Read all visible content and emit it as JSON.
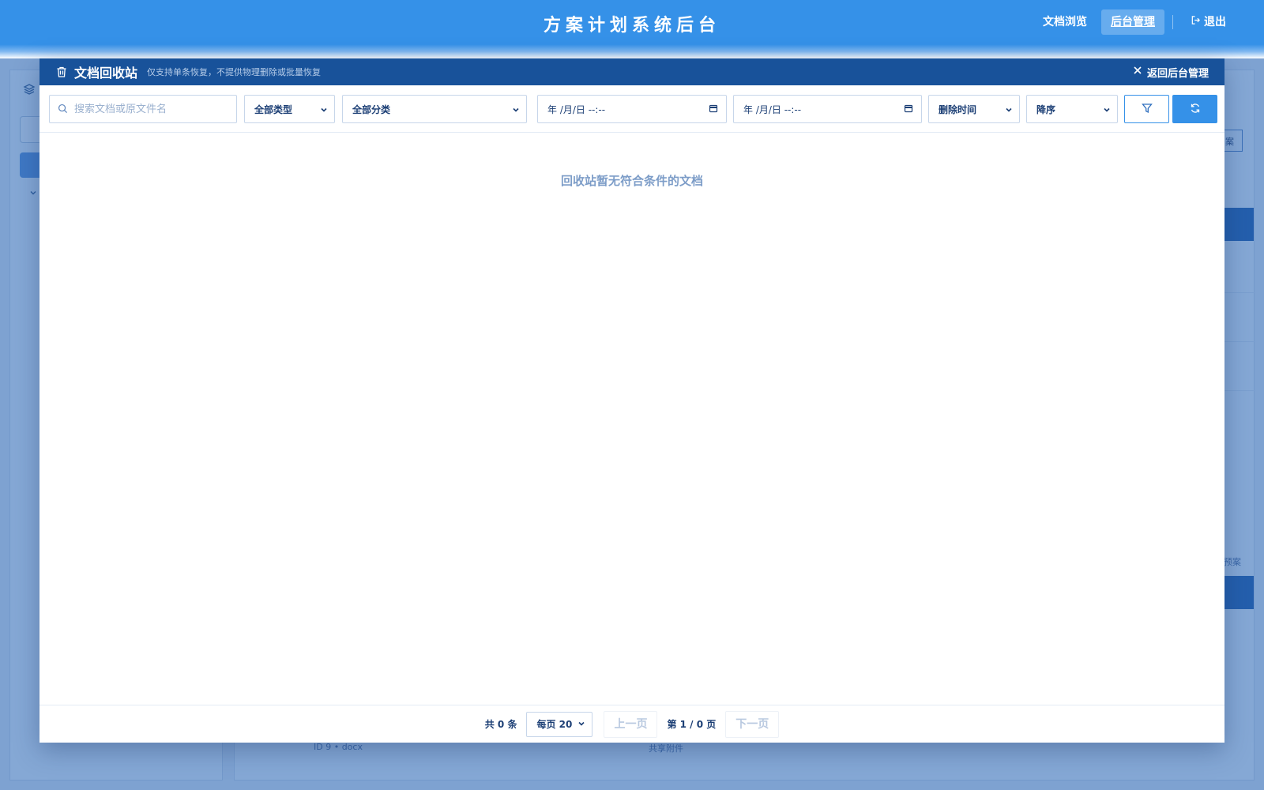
{
  "header": {
    "title": "方案计划系统后台",
    "nav": {
      "browse": "文档浏览",
      "admin": "后台管理",
      "logout": "退出"
    }
  },
  "background": {
    "outline_button_tail": "案",
    "side_link_tail": "预案",
    "row_meta": "ID 9 • docx",
    "row_tag": "共享附件"
  },
  "modal": {
    "title": "文档回收站",
    "subtitle": "仅支持单条恢复，不提供物理删除或批量恢复",
    "close_label": "返回后台管理",
    "filters": {
      "search_placeholder": "搜索文档或原文件名",
      "type_selected": "全部类型",
      "category_selected": "全部分类",
      "date_from": "年 /月/日 --:--",
      "date_to": "年 /月/日 --:--",
      "sort_field_selected": "删除时间",
      "sort_order_selected": "降序"
    },
    "empty_message": "回收站暂无符合条件的文档",
    "pagination": {
      "total": "共 0 条",
      "page_size_selected": "每页 20",
      "prev": "上一页",
      "page_info": "第 1 / 0 页",
      "next": "下一页"
    }
  },
  "colors": {
    "primary": "#3591e8",
    "modal_header": "#18529a",
    "text": "#1c3f75",
    "muted": "#7d9dc8"
  }
}
